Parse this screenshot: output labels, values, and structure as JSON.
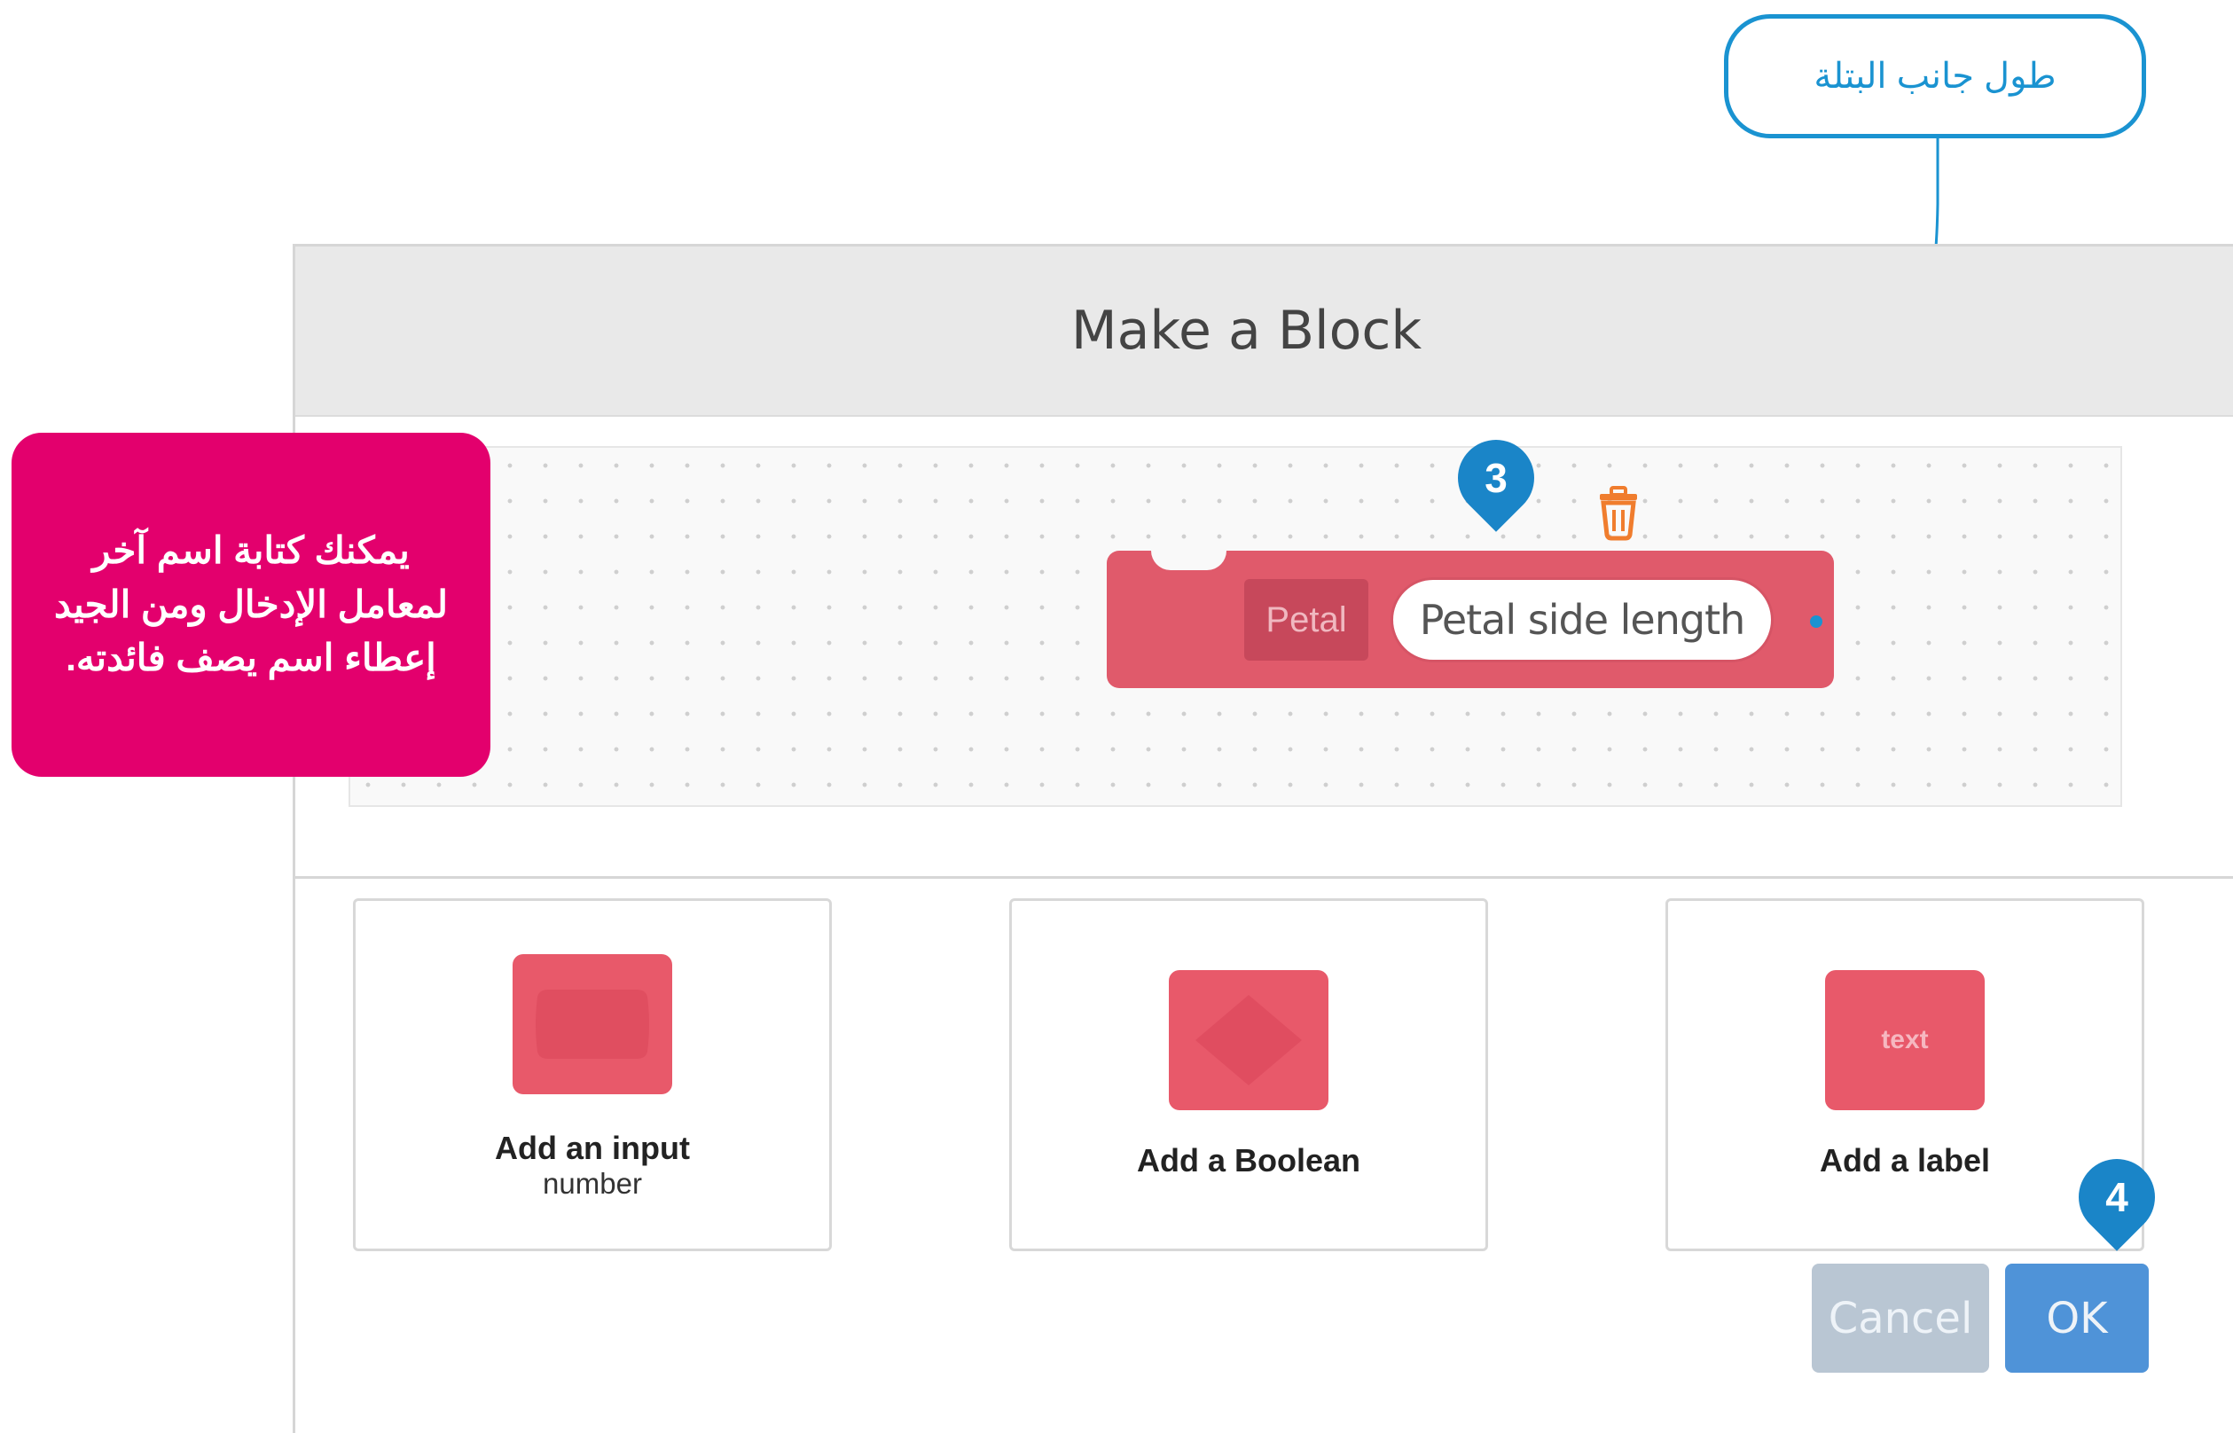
{
  "dialog": {
    "title": "Make a Block"
  },
  "block": {
    "label": "Petal",
    "input_value": "Petal side length"
  },
  "cards": [
    {
      "title": "Add an input",
      "subtitle": "number"
    },
    {
      "title": "Add a Boolean"
    },
    {
      "title": "Add a label",
      "icon_text": "text"
    }
  ],
  "buttons": {
    "cancel": "Cancel",
    "ok": "OK"
  },
  "annotations": {
    "pink_callout": "يمكنك كتابة اسم آخر لمعامل الإدخال ومن الجيد إعطاء اسم يصف فائدته.",
    "blue_callout": "طول جانب البتلة",
    "marker_3": "3",
    "marker_4": "4"
  },
  "colors": {
    "block": "#e05a6b",
    "ok_button": "#4f93d8",
    "cancel_button": "#b9c6d3",
    "callout_pink": "#e3006d",
    "callout_blue": "#1a93d1"
  }
}
